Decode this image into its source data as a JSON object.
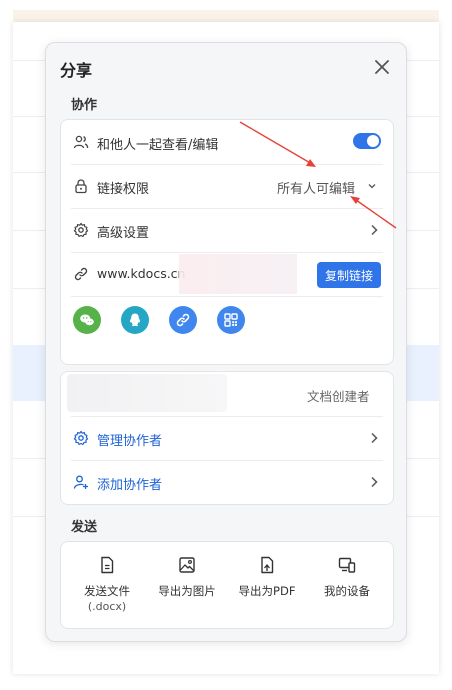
{
  "dialog": {
    "title": "分享",
    "section_collab": "协作",
    "section_send": "发送"
  },
  "collab": {
    "coedit_label": "和他人一起查看/编辑",
    "coedit_enabled": true,
    "permission_label": "链接权限",
    "permission_value": "所有人可编辑",
    "advanced_label": "高级设置",
    "link_text": "www.kdocs.cn",
    "copy_button": "复制链接"
  },
  "share_targets": [
    {
      "name": "wechat",
      "color": "#57b24a"
    },
    {
      "name": "qq",
      "color": "#25a6c4"
    },
    {
      "name": "link",
      "color": "#3f86ee"
    },
    {
      "name": "qrcode",
      "color": "#3f86ee"
    }
  ],
  "collaborators": {
    "owner_role": "文档创建者",
    "manage_label": "管理协作者",
    "add_label": "添加协作者"
  },
  "send": {
    "file_label": "发送文件",
    "file_ext": "(.docx)",
    "image_label": "导出为图片",
    "pdf_label": "导出为PDF",
    "device_label": "我的设备"
  },
  "colors": {
    "accent": "#2f74e8",
    "link_blue": "#1e63d6",
    "annotation_red": "#e8413c"
  }
}
